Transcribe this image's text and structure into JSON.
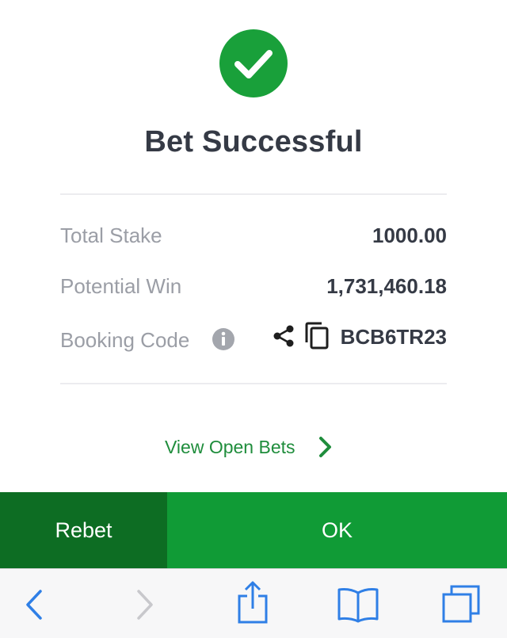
{
  "status": {
    "title": "Bet Successful",
    "icon": "checkmark-circle-icon",
    "accent_color": "#19a03a"
  },
  "summary": {
    "total_stake": {
      "label": "Total Stake",
      "value": "1000.00"
    },
    "potential_win": {
      "label": "Potential Win",
      "value": "1,731,460.18"
    },
    "booking_code": {
      "label": "Booking Code",
      "value": "BCB6TR23"
    }
  },
  "icons": {
    "info": "info-icon",
    "share": "share-icon",
    "copy": "copy-icon",
    "chevron": "chevron-right-icon"
  },
  "links": {
    "view_open_bets": "View Open Bets"
  },
  "actions": {
    "rebet_label": "Rebet",
    "ok_label": "OK",
    "rebet_color": "#0d6d23",
    "ok_color": "#109b36"
  },
  "browser_toolbar": {
    "items": [
      "back-icon",
      "forward-icon",
      "share-icon",
      "bookmarks-icon",
      "tabs-icon"
    ],
    "tint_color": "#2f7fe6"
  }
}
